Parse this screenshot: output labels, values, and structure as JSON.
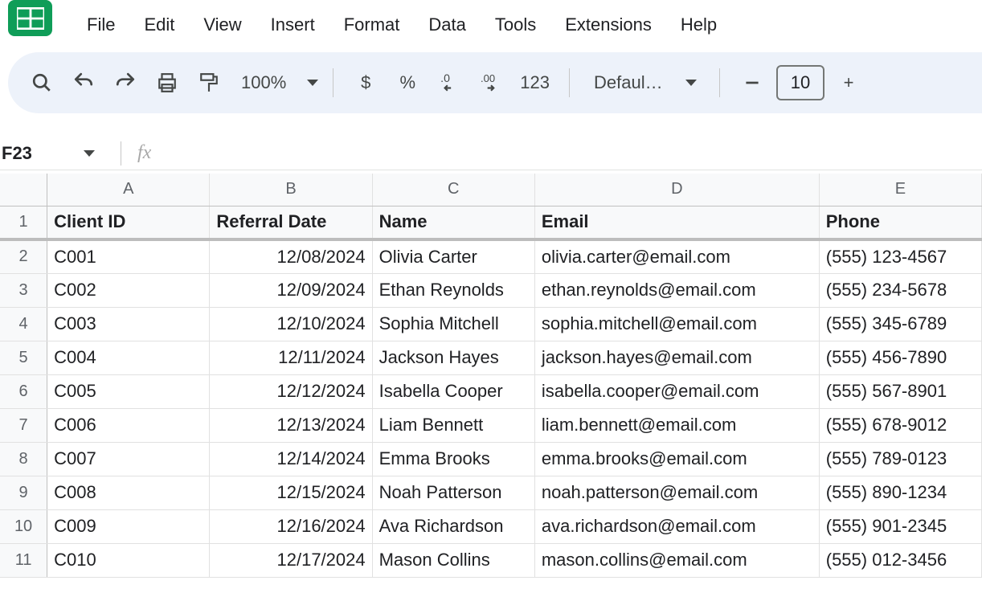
{
  "menus": [
    "File",
    "Edit",
    "View",
    "Insert",
    "Format",
    "Data",
    "Tools",
    "Extensions",
    "Help"
  ],
  "toolbar": {
    "zoom": "100%",
    "currency": "$",
    "percent": "%",
    "numfmt": "123",
    "font": "Defaul…",
    "font_size": "10",
    "plus": "+"
  },
  "name_box": "F23",
  "fx": "fx",
  "columns": [
    "A",
    "B",
    "C",
    "D",
    "E"
  ],
  "headers": [
    "Client ID",
    "Referral Date",
    "Name",
    "Email",
    "Phone"
  ],
  "rows": [
    {
      "n": "2",
      "id": "C001",
      "date": "12/08/2024",
      "name": "Olivia Carter",
      "email": "olivia.carter@email.com",
      "phone": "(555) 123-4567"
    },
    {
      "n": "3",
      "id": "C002",
      "date": "12/09/2024",
      "name": "Ethan Reynolds",
      "email": "ethan.reynolds@email.com",
      "phone": "(555) 234-5678"
    },
    {
      "n": "4",
      "id": "C003",
      "date": "12/10/2024",
      "name": "Sophia Mitchell",
      "email": "sophia.mitchell@email.com",
      "phone": "(555) 345-6789"
    },
    {
      "n": "5",
      "id": "C004",
      "date": "12/11/2024",
      "name": "Jackson Hayes",
      "email": "jackson.hayes@email.com",
      "phone": "(555) 456-7890"
    },
    {
      "n": "6",
      "id": "C005",
      "date": "12/12/2024",
      "name": "Isabella Cooper",
      "email": "isabella.cooper@email.com",
      "phone": "(555) 567-8901"
    },
    {
      "n": "7",
      "id": "C006",
      "date": "12/13/2024",
      "name": "Liam Bennett",
      "email": "liam.bennett@email.com",
      "phone": "(555) 678-9012"
    },
    {
      "n": "8",
      "id": "C007",
      "date": "12/14/2024",
      "name": "Emma Brooks",
      "email": "emma.brooks@email.com",
      "phone": "(555) 789-0123"
    },
    {
      "n": "9",
      "id": "C008",
      "date": "12/15/2024",
      "name": "Noah Patterson",
      "email": "noah.patterson@email.com",
      "phone": "(555) 890-1234"
    },
    {
      "n": "10",
      "id": "C009",
      "date": "12/16/2024",
      "name": "Ava Richardson",
      "email": "ava.richardson@email.com",
      "phone": "(555) 901-2345"
    },
    {
      "n": "11",
      "id": "C010",
      "date": "12/17/2024",
      "name": "Mason Collins",
      "email": "mason.collins@email.com",
      "phone": "(555) 012-3456"
    }
  ]
}
